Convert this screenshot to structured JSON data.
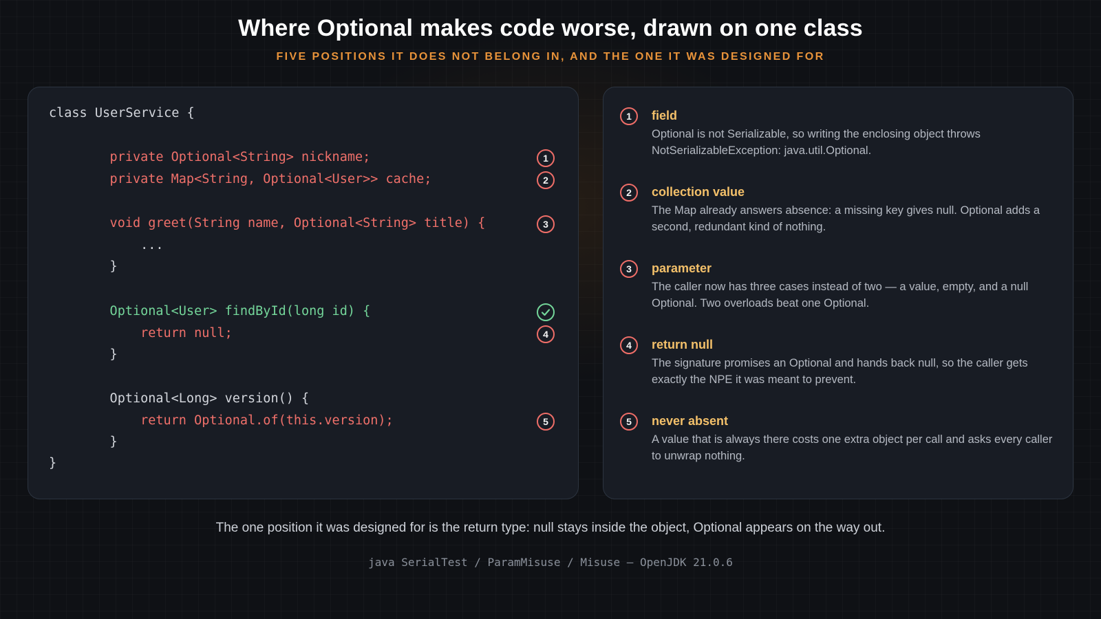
{
  "title": "Where Optional makes code worse, drawn on one class",
  "subtitle": "FIVE POSITIONS IT DOES NOT BELONG IN, AND THE ONE IT WAS DESIGNED FOR",
  "code": {
    "lines": [
      "class UserService {",
      "    private Optional<String> nickname;",
      "    private Map<String, Optional<User>> cache;",
      "    void greet(String name, Optional<String> title) {",
      "        ...",
      "    }",
      "    Optional<User> findById(long id) {",
      "        return null;",
      "    }",
      "    Optional<Long> version() {",
      "        return Optional.of(this.version);",
      "    }",
      "}"
    ],
    "markers": [
      "1",
      "2",
      "3",
      "check",
      "4",
      "5"
    ]
  },
  "notes": [
    {
      "num": "1",
      "title": "field",
      "body": "Optional is not Serializable, so writing the enclosing object throws NotSerializableException: java.util.Optional."
    },
    {
      "num": "2",
      "title": "collection value",
      "body": "The Map already answers absence: a missing key gives null. Optional adds a second, redundant kind of nothing."
    },
    {
      "num": "3",
      "title": "parameter",
      "body": "The caller now has three cases instead of two — a value, empty, and a null Optional. Two overloads beat one Optional."
    },
    {
      "num": "4",
      "title": "return null",
      "body": "The signature promises an Optional and hands back null, so the caller gets exactly the NPE it was meant to prevent."
    },
    {
      "num": "5",
      "title": "never absent",
      "body": "A value that is always there costs one extra object per call and asks every caller to unwrap nothing."
    }
  ],
  "summary": "The one position it was designed for is the return type: null stays inside the object, Optional appears on the way out.",
  "footer": "java SerialTest / ParamMisuse / Misuse — OpenJDK 21.0.6",
  "colors": {
    "background": "#0f1115",
    "accent_orange": "#e8933a",
    "misuse_red": "#f0706a",
    "correct_green": "#74d69a",
    "note_title": "#f3c06a"
  }
}
